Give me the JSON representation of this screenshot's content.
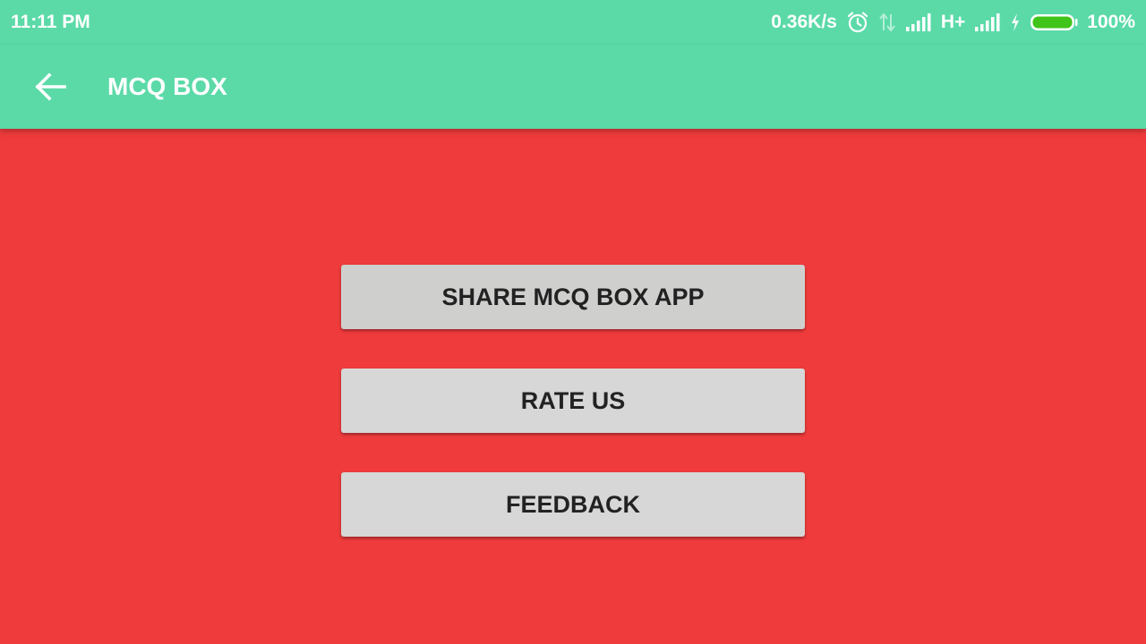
{
  "status_bar": {
    "time": "11:11 PM",
    "network_speed": "0.36K/s",
    "network_type": "H+",
    "battery_percent": "100%",
    "battery_level": 1.0,
    "icons": [
      "alarm-icon",
      "data-transfer-icon",
      "signal-icon",
      "signal-icon",
      "charging-icon",
      "battery-icon"
    ],
    "battery_color": "#3fc41a"
  },
  "app_bar": {
    "title": "MCQ BOX",
    "back_icon": "arrow-back-icon",
    "color": "#5bdaa8"
  },
  "main": {
    "background_color": "#ef3b3c",
    "buttons": [
      {
        "label": "SHARE MCQ BOX APP"
      },
      {
        "label": "RATE US"
      },
      {
        "label": "FEEDBACK"
      }
    ]
  }
}
